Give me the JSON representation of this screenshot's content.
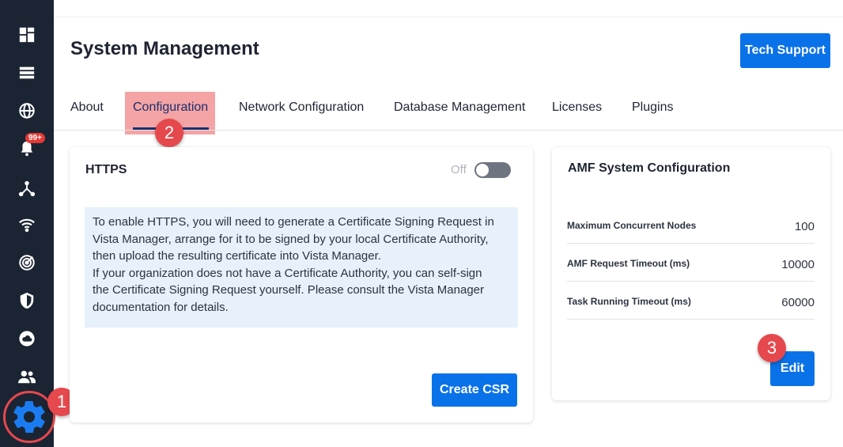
{
  "header": {
    "title": "System Management",
    "tech_support_label": "Tech Support"
  },
  "tabs": [
    {
      "label": "About"
    },
    {
      "label": "Configuration",
      "active": true
    },
    {
      "label": "Network Configuration"
    },
    {
      "label": "Database Management"
    },
    {
      "label": "Licenses"
    },
    {
      "label": "Plugins"
    }
  ],
  "sidebar": {
    "items": [
      {
        "icon": "dashboard-icon"
      },
      {
        "icon": "list-icon"
      },
      {
        "icon": "globe-icon"
      },
      {
        "icon": "bell-icon",
        "badge": "99+"
      },
      {
        "icon": "topology-icon"
      },
      {
        "icon": "wifi-icon"
      },
      {
        "icon": "radar-icon"
      },
      {
        "icon": "shield-icon"
      },
      {
        "icon": "cloud-icon"
      },
      {
        "icon": "users-icon"
      },
      {
        "icon": "gear-icon",
        "active": true
      }
    ]
  },
  "https": {
    "title": "HTTPS",
    "toggle_label": "Off",
    "toggle_on": false,
    "info_lines": [
      "To enable HTTPS, you will need to generate a Certificate Signing Request in",
      "Vista Manager, arrange for it to be signed by your local Certificate Authority,",
      "then upload the resulting certificate into Vista Manager.",
      "If your organization does not have a Certificate Authority, you can self-sign",
      "the Certificate Signing Request yourself. Please consult the Vista Manager",
      "documentation for details."
    ],
    "create_csr_label": "Create CSR"
  },
  "amf": {
    "title": "AMF System Configuration",
    "rows": [
      {
        "label": "Maximum Concurrent Nodes",
        "value": "100"
      },
      {
        "label": "AMF Request Timeout (ms)",
        "value": "10000"
      },
      {
        "label": "Task Running Timeout (ms)",
        "value": "60000"
      }
    ],
    "edit_label": "Edit"
  },
  "markers": {
    "one": "1",
    "two": "2",
    "three": "3"
  },
  "colors": {
    "sidebar": "#1b2433",
    "primary": "#0a72e8",
    "marker": "#e5484d",
    "info_bg": "#e6f1fb"
  }
}
